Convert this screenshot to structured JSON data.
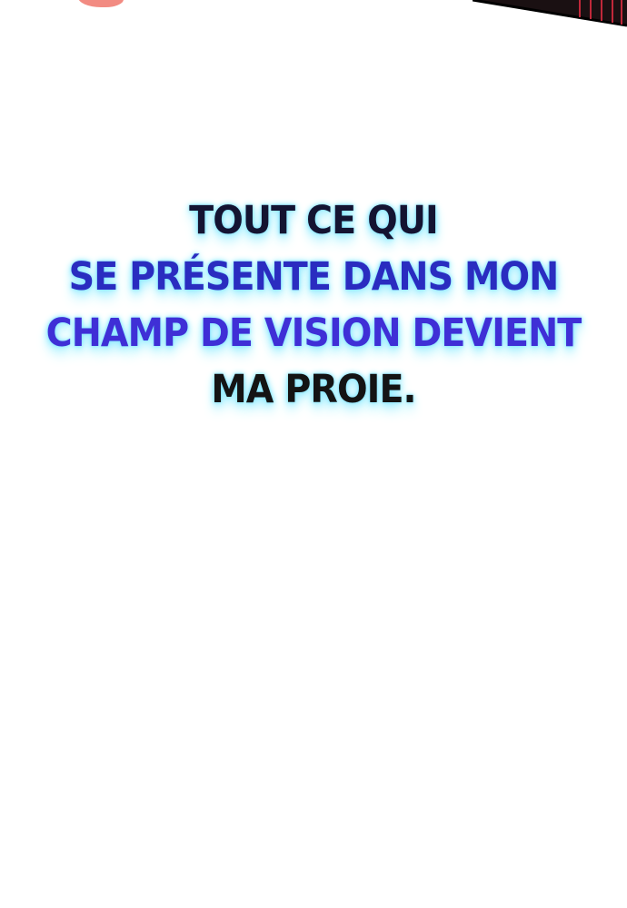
{
  "caption": {
    "lines": [
      "TOUT CE QUI",
      "SE PRÉSENTE DANS MON",
      "CHAMP DE VISION DEVIENT",
      "MA PROIE."
    ],
    "gradient_colors": [
      "#141432",
      "#2a2cc0",
      "#3f2fd6",
      "#141414"
    ],
    "glow_color": "#8fe8ff"
  },
  "decor": {
    "blob_color": "#f28b82",
    "panel_color": "#1a1012",
    "panel_stripe_color": "#c0283a"
  }
}
